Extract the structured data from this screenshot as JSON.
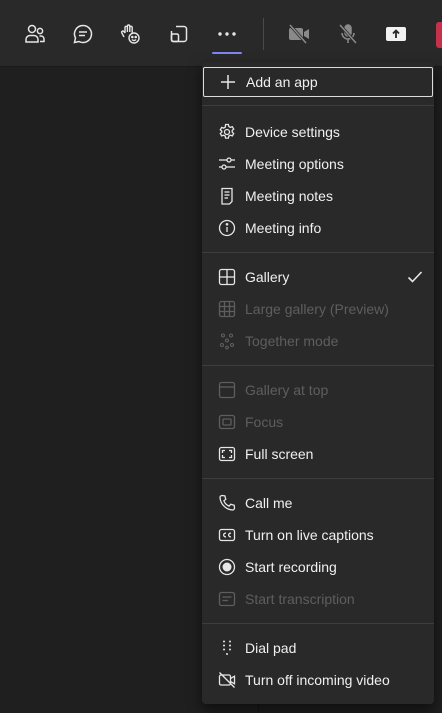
{
  "toolbar": {
    "buttons": [
      {
        "name": "people-button",
        "icon": "people-icon"
      },
      {
        "name": "chat-button",
        "icon": "chat-bubble-icon"
      },
      {
        "name": "raise-hand-button",
        "icon": "hand-emoji-icon"
      },
      {
        "name": "rooms-button",
        "icon": "rooms-icon"
      },
      {
        "name": "more-actions-button",
        "icon": "ellipsis-icon",
        "active": true
      },
      {
        "name": "camera-button",
        "icon": "camera-off-icon"
      },
      {
        "name": "mic-button",
        "icon": "mic-off-icon"
      },
      {
        "name": "share-button",
        "icon": "share-tray-icon"
      }
    ],
    "active_indicator_color": "#7f85f5",
    "leave_button_color": "#c4314b"
  },
  "menu": {
    "add_app": {
      "label": "Add an app",
      "icon": "plus-icon"
    },
    "groups": [
      [
        {
          "label": "Device settings",
          "icon": "gear-icon",
          "enabled": true
        },
        {
          "label": "Meeting options",
          "icon": "sliders-icon",
          "enabled": true
        },
        {
          "label": "Meeting notes",
          "icon": "notes-icon",
          "enabled": true
        },
        {
          "label": "Meeting info",
          "icon": "info-icon",
          "enabled": true
        }
      ],
      [
        {
          "label": "Gallery",
          "icon": "gallery-grid-icon",
          "enabled": true,
          "checked": true
        },
        {
          "label": "Large gallery (Preview)",
          "icon": "large-gallery-icon",
          "enabled": false
        },
        {
          "label": "Together mode",
          "icon": "together-mode-icon",
          "enabled": false
        }
      ],
      [
        {
          "label": "Gallery at top",
          "icon": "gallery-top-icon",
          "enabled": false
        },
        {
          "label": "Focus",
          "icon": "focus-icon",
          "enabled": false
        },
        {
          "label": "Full screen",
          "icon": "fullscreen-icon",
          "enabled": true
        }
      ],
      [
        {
          "label": "Call me",
          "icon": "phone-icon",
          "enabled": true
        },
        {
          "label": "Turn on live captions",
          "icon": "cc-icon",
          "enabled": true
        },
        {
          "label": "Start recording",
          "icon": "record-icon",
          "enabled": true
        },
        {
          "label": "Start transcription",
          "icon": "transcript-icon",
          "enabled": false
        }
      ],
      [
        {
          "label": "Dial pad",
          "icon": "dial-pad-icon",
          "enabled": true
        },
        {
          "label": "Turn off incoming video",
          "icon": "video-off-icon",
          "enabled": true
        }
      ]
    ]
  }
}
